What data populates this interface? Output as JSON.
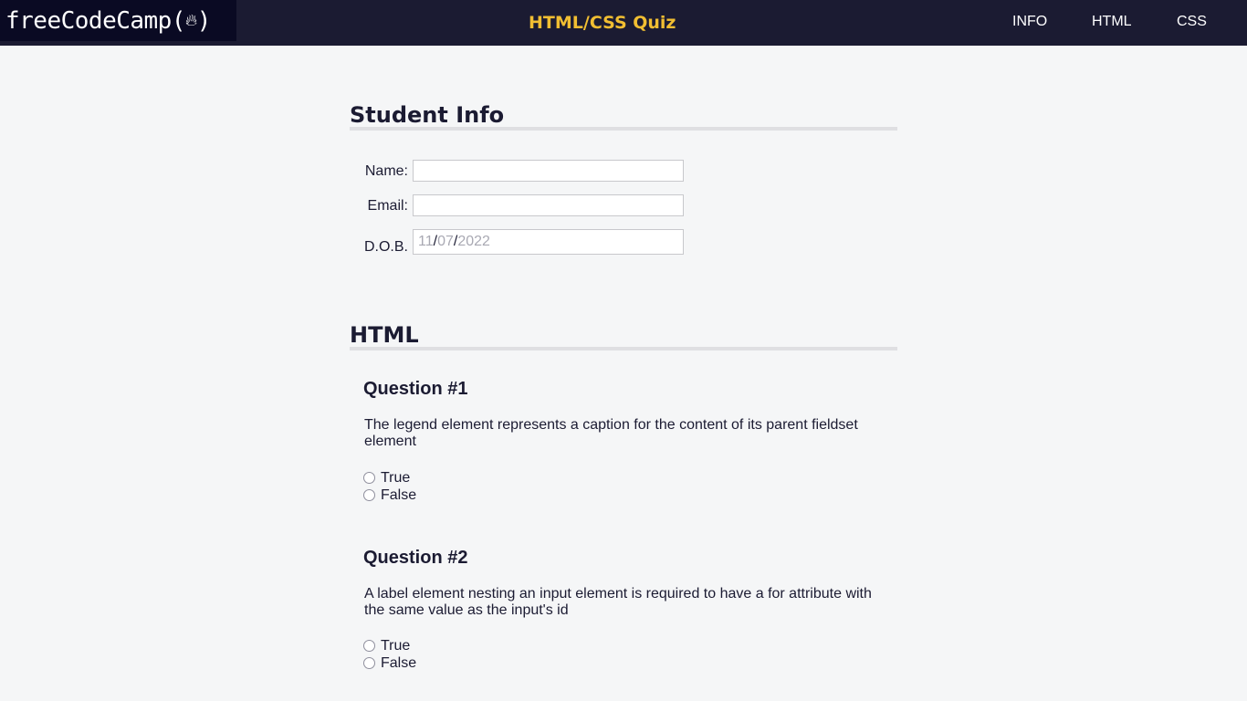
{
  "header": {
    "logo_text": "freeCodeCamp(",
    "logo_close": ")",
    "logo_icon": "flame-icon",
    "title": "HTML/CSS Quiz",
    "nav": [
      "INFO",
      "HTML",
      "CSS"
    ]
  },
  "student_info": {
    "heading": "Student Info",
    "name_label": "Name:",
    "name_value": "",
    "email_label": "Email:",
    "email_value": "",
    "dob_label": "D.O.B.",
    "dob": {
      "month": "11",
      "day": "07",
      "year": "2022",
      "separator": "/"
    }
  },
  "html_section": {
    "heading": "HTML",
    "questions": [
      {
        "title": "Question #1",
        "text": "The legend element represents a caption for the content of its parent fieldset element",
        "options": [
          "True",
          "False"
        ]
      },
      {
        "title": "Question #2",
        "text": "A label element nesting an input element is required to have a for attribute with the same value as the input's id",
        "options": [
          "True",
          "False"
        ]
      }
    ]
  },
  "colors": {
    "header_bg": "#1b1b32",
    "logo_bg": "#0a0a23",
    "accent": "#f1be32",
    "page_bg": "#f5f6f7",
    "text": "#1b1b32"
  }
}
